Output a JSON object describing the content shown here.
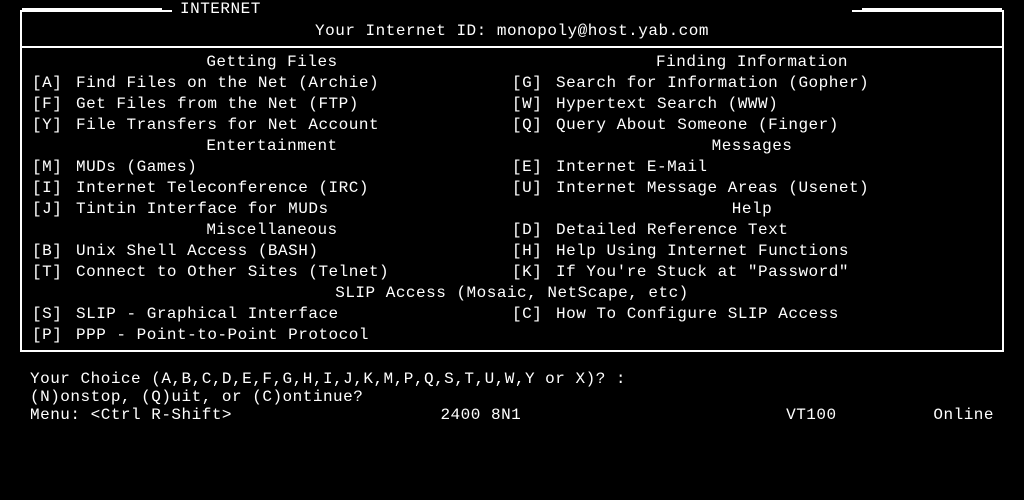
{
  "title": "INTERNET",
  "id_line": "Your Internet ID: monopoly@host.yab.com",
  "headings": {
    "getting_files": "Getting Files",
    "finding_info": "Finding Information",
    "entertainment": "Entertainment",
    "messages": "Messages",
    "help": "Help",
    "misc": "Miscellaneous",
    "slip": "SLIP Access (Mosaic, NetScape, etc)"
  },
  "items": {
    "A": "Find Files on the Net (Archie)",
    "F": "Get Files from the Net (FTP)",
    "Y": "File Transfers for Net Account",
    "M": "MUDs (Games)",
    "I": "Internet Teleconference (IRC)",
    "J": "Tintin Interface for MUDs",
    "B": "Unix Shell Access (BASH)",
    "T": "Connect to Other Sites (Telnet)",
    "S": "SLIP - Graphical Interface",
    "P": "PPP - Point-to-Point Protocol",
    "G": "Search for Information (Gopher)",
    "W": "Hypertext Search (WWW)",
    "Q": "Query About Someone (Finger)",
    "E": "Internet E-Mail",
    "U": "Internet Message Areas (Usenet)",
    "D": "Detailed Reference Text",
    "H": "Help Using Internet Functions",
    "K": "If You're Stuck at \"Password\"",
    "C": "How To Configure SLIP Access"
  },
  "keys": {
    "A": "[A]",
    "F": "[F]",
    "Y": "[Y]",
    "M": "[M]",
    "I": "[I]",
    "J": "[J]",
    "B": "[B]",
    "T": "[T]",
    "S": "[S]",
    "P": "[P]",
    "G": "[G]",
    "W": "[W]",
    "Q": "[Q]",
    "E": "[E]",
    "U": "[U]",
    "D": "[D]",
    "H": "[H]",
    "K": "[K]",
    "C": "[C]"
  },
  "prompt": "Your Choice (A,B,C,D,E,F,G,H,I,J,K,M,P,Q,S,T,U,W,Y or X)? :",
  "prompt2": "(N)onstop, (Q)uit, or (C)ontinue?",
  "status": {
    "menu": "Menu: <Ctrl R-Shift>",
    "baud": "2400 8N1",
    "term": "VT100",
    "online": "Online"
  }
}
